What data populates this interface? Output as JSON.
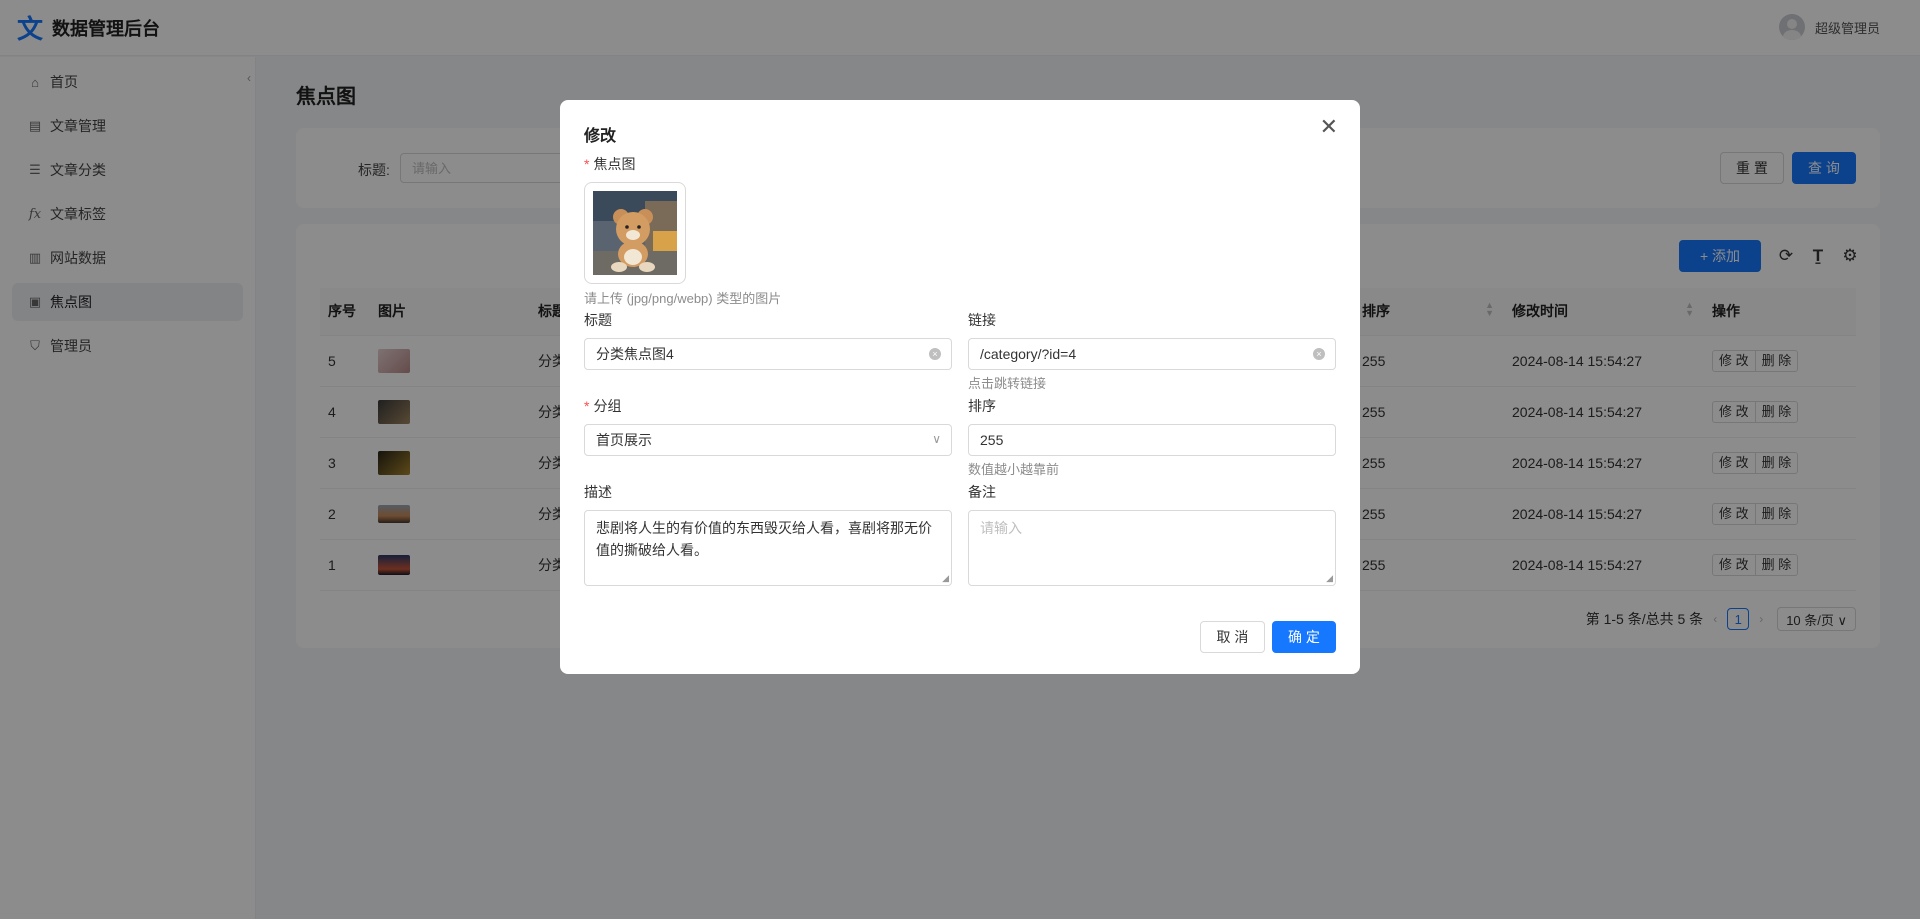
{
  "app": {
    "logo_char": "文",
    "title": "数据管理后台",
    "user": "超级管理员"
  },
  "sidebar": {
    "collapse": "‹",
    "items": [
      {
        "label": "首页",
        "icon": "⌂"
      },
      {
        "label": "文章管理",
        "icon": "▤"
      },
      {
        "label": "文章分类",
        "icon": "☰"
      },
      {
        "label": "文章标签",
        "icon": "fx"
      },
      {
        "label": "网站数据",
        "icon": "▥"
      },
      {
        "label": "焦点图",
        "icon": "▣",
        "active": true
      },
      {
        "label": "管理员",
        "icon": "⛉"
      }
    ]
  },
  "page": {
    "title": "焦点图"
  },
  "search": {
    "label": "标题:",
    "placeholder": "请输入",
    "reset": "重 置",
    "query": "查 询"
  },
  "toolbar": {
    "add": "+ 添加",
    "refresh_icon": "refresh-icon",
    "density_icon": "column-height-icon",
    "settings_icon": "setting-icon"
  },
  "table": {
    "headers": {
      "seq": "序号",
      "image": "图片",
      "title": "标题",
      "sort": "排序",
      "time": "修改时间",
      "actions": "操作"
    },
    "rows": [
      {
        "seq": "5",
        "title": "分类",
        "sort": "255",
        "time": "2024-08-14 15:54:27",
        "thumb_color": "#c9a6a6"
      },
      {
        "seq": "4",
        "title": "分类",
        "sort": "255",
        "time": "2024-08-14 15:54:27",
        "thumb_color": "#7a6a55"
      },
      {
        "seq": "3",
        "title": "分类",
        "sort": "255",
        "time": "2024-08-14 15:54:27",
        "thumb_color": "#6b5a2e"
      },
      {
        "seq": "2",
        "title": "分类",
        "sort": "255",
        "time": "2024-08-14 15:54:27",
        "thumb_color": "#b08a6a"
      },
      {
        "seq": "1",
        "title": "分类",
        "sort": "255",
        "time": "2024-08-14 15:54:27",
        "thumb_color": "#5a4a6a"
      }
    ],
    "edit": "修 改",
    "delete": "删 除"
  },
  "pagination": {
    "summary": "第 1-5 条/总共 5 条",
    "prev": "‹",
    "page": "1",
    "next": "›",
    "size": "10 条/页 ∨"
  },
  "modal": {
    "title": "修改",
    "close": "✕",
    "image_label": "焦点图",
    "upload_hint": "请上传 (jpg/png/webp) 类型的图片",
    "title_label": "标题",
    "title_value": "分类焦点图4",
    "link_label": "链接",
    "link_value": "/category/?id=4",
    "link_help": "点击跳转链接",
    "group_label": "分组",
    "group_value": "首页展示",
    "sort_label": "排序",
    "sort_value": "255",
    "sort_help": "数值越小越靠前",
    "desc_label": "描述",
    "desc_value": "悲剧将人生的有价值的东西毁灭给人看，喜剧将那无价值的撕破给人看。",
    "remark_label": "备注",
    "remark_placeholder": "请输入",
    "cancel": "取 消",
    "ok": "确 定",
    "required_mark": "*",
    "clear_mark": "×",
    "chevron": "∨",
    "grip": "◢"
  }
}
